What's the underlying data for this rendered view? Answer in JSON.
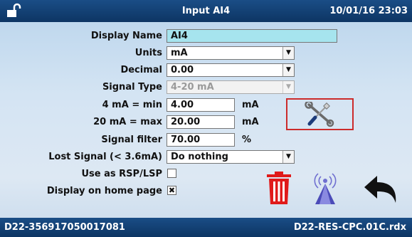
{
  "header": {
    "title": "Input AI4",
    "datetime": "10/01/16 23:03",
    "lock_icon": "unlocked-padlock-icon"
  },
  "form": {
    "display_name": {
      "label": "Display Name",
      "value": "AI4"
    },
    "units": {
      "label": "Units",
      "value": "mA"
    },
    "decimal": {
      "label": "Decimal",
      "value": "0.00"
    },
    "signal_type": {
      "label": "Signal Type",
      "value": "4-20 mA"
    },
    "min": {
      "label": "4 mA = min",
      "value": "4.00",
      "unit": "mA"
    },
    "max": {
      "label": "20 mA = max",
      "value": "20.00",
      "unit": "mA"
    },
    "filter": {
      "label": "Signal filter",
      "value": "70.00",
      "unit": "%"
    },
    "lost_signal": {
      "label": "Lost Signal (< 3.6mA)",
      "value": "Do nothing"
    },
    "use_rsp": {
      "label": "Use as RSP/LSP",
      "checked": false
    },
    "home_page": {
      "label": "Display on home page",
      "checked": true,
      "mark": "✖"
    }
  },
  "actions": {
    "calibrate_icon": "tools-calibrate-icon",
    "delete_icon": "trash-icon",
    "wireless_icon": "wireless-tower-icon",
    "back_icon": "back-arrow-icon"
  },
  "footer": {
    "serial": "D22-356917050017081",
    "file": "D22-RES-CPC.01C.rdx"
  },
  "colors": {
    "bar": "#0d3563",
    "field_highlight": "#a6e4ee",
    "delete": "#e01a1a",
    "calibrate_border": "#cc2b2b"
  }
}
